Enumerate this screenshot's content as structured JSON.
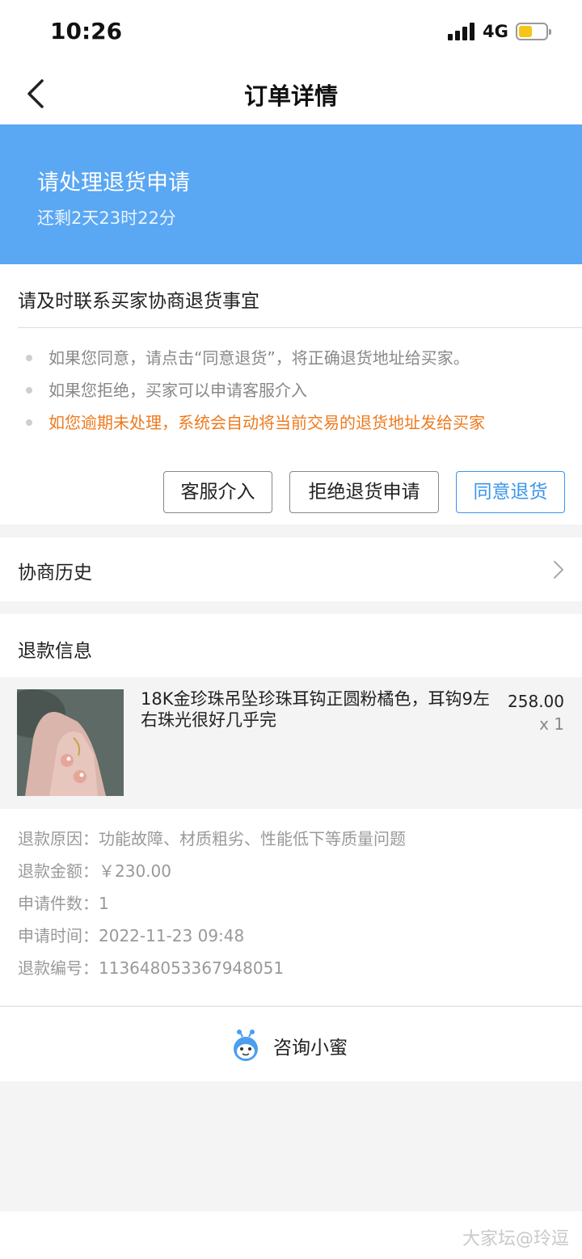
{
  "status_bar": {
    "time": "10:26",
    "network": "4G"
  },
  "nav": {
    "title": "订单详情"
  },
  "banner": {
    "title": "请处理退货申请",
    "subtitle": "还剩2天23时22分"
  },
  "action_card": {
    "title": "请及时联系买家协商退货事宜",
    "bullets": [
      "如果您同意，请点击“同意退货”，将正确退货地址给买家。",
      "如果您拒绝，买家可以申请客服介入",
      "如您逾期未处理，系统会自动将当前交易的退货地址发给买家"
    ],
    "buttons": {
      "service": "客服介入",
      "reject": "拒绝退货申请",
      "agree": "同意退货"
    }
  },
  "history": {
    "label": "协商历史"
  },
  "refund": {
    "title": "退款信息",
    "product": {
      "name": "18K金珍珠吊坠珍珠耳钩正圆粉橘色，耳钩9左右珠光很好几乎完",
      "price": "258.00",
      "qty": "x 1"
    },
    "details": [
      {
        "label": "退款原因：",
        "value": "功能故障、材质粗劣、性能低下等质量问题"
      },
      {
        "label": "退款金额：",
        "value": "￥230.00"
      },
      {
        "label": "申请件数：",
        "value": "1"
      },
      {
        "label": "申请时间：",
        "value": "2022-11-23 09:48"
      },
      {
        "label": "退款编号：",
        "value": "113648053367948051"
      }
    ]
  },
  "consult": {
    "label": "咨询小蜜"
  },
  "watermark": "大家坛@玲逗",
  "colors": {
    "banner": "#5aa7f3",
    "accent": "#3b95ea",
    "warning": "#ee7a1e"
  }
}
